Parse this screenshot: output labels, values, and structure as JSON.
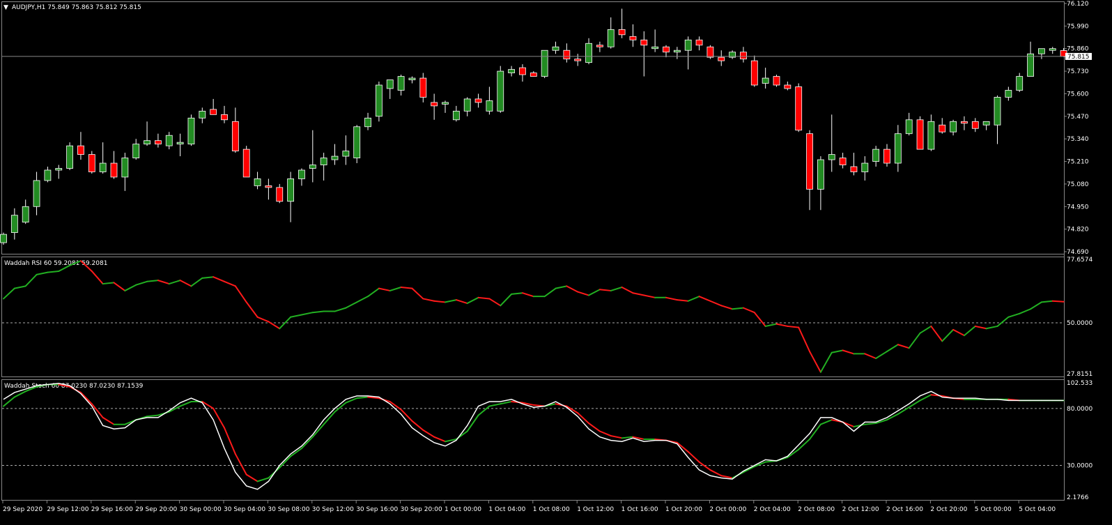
{
  "header": {
    "symbol_info": "AUDJPY,H1  75.849 75.863 75.812 75.815",
    "rsi_title": "Waddah RSI 60 59.2081 59.2081",
    "stoch_title": "Waddah Stoch 60 87.0230 87.0230 87.1539"
  },
  "price_pane": {
    "ticks": [
      "76.120",
      "75.990",
      "75.860",
      "75.730",
      "75.600",
      "75.470",
      "75.340",
      "75.210",
      "75.080",
      "74.950",
      "74.820",
      "74.690"
    ],
    "current_price_label": "75.815",
    "current_price": 75.815
  },
  "rsi_pane": {
    "ticks": [
      "77.6574",
      "50.0000",
      "27.8151"
    ],
    "level": 50
  },
  "stoch_pane": {
    "ticks": [
      "102.533",
      "80.0000",
      "30.0000",
      "2.1766"
    ],
    "levels": [
      80,
      30
    ]
  },
  "time_axis": [
    "29 Sep 2020",
    "29 Sep 12:00",
    "29 Sep 16:00",
    "29 Sep 20:00",
    "30 Sep 00:00",
    "30 Sep 04:00",
    "30 Sep 08:00",
    "30 Sep 12:00",
    "30 Sep 16:00",
    "30 Sep 20:00",
    "1 Oct 00:00",
    "1 Oct 04:00",
    "1 Oct 08:00",
    "1 Oct 12:00",
    "1 Oct 16:00",
    "1 Oct 20:00",
    "2 Oct 00:00",
    "2 Oct 04:00",
    "2 Oct 08:00",
    "2 Oct 12:00",
    "2 Oct 16:00",
    "2 Oct 20:00",
    "5 Oct 00:00",
    "5 Oct 04:00"
  ],
  "colors": {
    "bull": "#228B22",
    "bear": "#FF0000",
    "wick": "#FFFFFF",
    "background": "#000000",
    "line_green": "#22B022",
    "line_red": "#FF1A1A",
    "line_white": "#FFFFFF"
  },
  "chart_data": {
    "type": "candlestick",
    "timeframe": "H1",
    "symbol": "AUDJPY",
    "candles": [
      [
        74.742,
        74.8,
        74.73,
        74.79
      ],
      [
        74.8,
        74.94,
        74.76,
        74.9
      ],
      [
        74.86,
        74.99,
        74.85,
        74.95
      ],
      [
        74.95,
        75.15,
        74.9,
        75.1
      ],
      [
        75.1,
        75.18,
        75.09,
        75.16
      ],
      [
        75.16,
        75.19,
        75.11,
        75.17
      ],
      [
        75.17,
        75.32,
        75.16,
        75.3
      ],
      [
        75.3,
        75.38,
        75.22,
        75.25
      ],
      [
        75.25,
        75.27,
        75.14,
        75.15
      ],
      [
        75.15,
        75.32,
        75.14,
        75.2
      ],
      [
        75.2,
        75.27,
        75.11,
        75.12
      ],
      [
        75.12,
        75.26,
        75.04,
        75.23
      ],
      [
        75.23,
        75.34,
        75.22,
        75.31
      ],
      [
        75.31,
        75.44,
        75.3,
        75.33
      ],
      [
        75.33,
        75.37,
        75.29,
        75.31
      ],
      [
        75.3,
        75.38,
        75.28,
        75.36
      ],
      [
        75.31,
        75.37,
        75.24,
        75.32
      ],
      [
        75.31,
        75.48,
        75.3,
        75.46
      ],
      [
        75.46,
        75.52,
        75.43,
        75.5
      ],
      [
        75.51,
        75.57,
        75.48,
        75.48
      ],
      [
        75.48,
        75.53,
        75.43,
        75.45
      ],
      [
        75.44,
        75.52,
        75.26,
        75.27
      ],
      [
        75.28,
        75.3,
        75.12,
        75.12
      ],
      [
        75.07,
        75.15,
        75.05,
        75.11
      ],
      [
        75.07,
        75.11,
        74.99,
        75.06
      ],
      [
        75.06,
        75.08,
        74.97,
        74.98
      ],
      [
        74.98,
        75.15,
        74.86,
        75.11
      ],
      [
        75.11,
        75.17,
        75.07,
        75.16
      ],
      [
        75.17,
        75.39,
        75.09,
        75.19
      ],
      [
        75.19,
        75.26,
        75.1,
        75.23
      ],
      [
        75.22,
        75.31,
        75.19,
        75.24
      ],
      [
        75.24,
        75.36,
        75.19,
        75.27
      ],
      [
        75.23,
        75.42,
        75.2,
        75.41
      ],
      [
        75.41,
        75.49,
        75.39,
        75.46
      ],
      [
        75.47,
        75.67,
        75.44,
        75.65
      ],
      [
        75.63,
        75.67,
        75.57,
        75.68
      ],
      [
        75.62,
        75.71,
        75.59,
        75.7
      ],
      [
        75.68,
        75.7,
        75.66,
        75.69
      ],
      [
        75.69,
        75.72,
        75.55,
        75.58
      ],
      [
        75.55,
        75.6,
        75.45,
        75.53
      ],
      [
        75.54,
        75.56,
        75.49,
        75.55
      ],
      [
        75.45,
        75.53,
        75.44,
        75.5
      ],
      [
        75.5,
        75.58,
        75.47,
        75.57
      ],
      [
        75.57,
        75.6,
        75.52,
        75.55
      ],
      [
        75.5,
        75.64,
        75.48,
        75.56
      ],
      [
        75.5,
        75.76,
        75.49,
        75.73
      ],
      [
        75.72,
        75.76,
        75.7,
        75.74
      ],
      [
        75.75,
        75.77,
        75.67,
        75.71
      ],
      [
        75.72,
        75.73,
        75.7,
        75.7
      ],
      [
        75.7,
        75.85,
        75.69,
        75.85
      ],
      [
        75.85,
        75.9,
        75.83,
        75.87
      ],
      [
        75.85,
        75.89,
        75.78,
        75.8
      ],
      [
        75.8,
        75.83,
        75.76,
        75.79
      ],
      [
        75.78,
        75.92,
        75.77,
        75.89
      ],
      [
        75.88,
        75.9,
        75.84,
        75.87
      ],
      [
        75.87,
        76.04,
        75.86,
        75.97
      ],
      [
        75.97,
        76.09,
        75.92,
        75.94
      ],
      [
        75.93,
        76.0,
        75.87,
        75.91
      ],
      [
        75.91,
        75.96,
        75.7,
        75.88
      ],
      [
        75.86,
        75.97,
        75.84,
        75.87
      ],
      [
        75.87,
        75.88,
        75.81,
        75.84
      ],
      [
        75.84,
        75.87,
        75.8,
        75.85
      ],
      [
        75.85,
        75.93,
        75.74,
        75.91
      ],
      [
        75.91,
        75.93,
        75.85,
        75.88
      ],
      [
        75.87,
        75.88,
        75.8,
        75.81
      ],
      [
        75.81,
        75.85,
        75.76,
        75.79
      ],
      [
        75.81,
        75.85,
        75.8,
        75.84
      ],
      [
        75.84,
        75.87,
        75.78,
        75.8
      ],
      [
        75.79,
        75.82,
        75.64,
        75.65
      ],
      [
        75.66,
        75.75,
        75.63,
        75.69
      ],
      [
        75.7,
        75.71,
        75.64,
        75.65
      ],
      [
        75.65,
        75.67,
        75.62,
        75.63
      ],
      [
        75.64,
        75.66,
        75.38,
        75.39
      ],
      [
        75.37,
        75.39,
        74.93,
        75.05
      ],
      [
        75.05,
        75.24,
        74.93,
        75.22
      ],
      [
        75.22,
        75.48,
        75.15,
        75.25
      ],
      [
        75.23,
        75.26,
        75.17,
        75.19
      ],
      [
        75.18,
        75.26,
        75.13,
        75.15
      ],
      [
        75.15,
        75.24,
        75.1,
        75.2
      ],
      [
        75.21,
        75.3,
        75.18,
        75.28
      ],
      [
        75.28,
        75.31,
        75.18,
        75.2
      ],
      [
        75.2,
        75.42,
        75.15,
        75.37
      ],
      [
        75.37,
        75.49,
        75.36,
        75.45
      ],
      [
        75.45,
        75.47,
        75.28,
        75.28
      ],
      [
        75.28,
        75.48,
        75.27,
        75.44
      ],
      [
        75.42,
        75.46,
        75.37,
        75.38
      ],
      [
        75.38,
        75.45,
        75.36,
        75.44
      ],
      [
        75.44,
        75.47,
        75.39,
        75.43
      ],
      [
        75.44,
        75.46,
        75.38,
        75.4
      ],
      [
        75.42,
        75.44,
        75.39,
        75.44
      ],
      [
        75.42,
        75.59,
        75.31,
        75.58
      ],
      [
        75.58,
        75.64,
        75.56,
        75.62
      ],
      [
        75.62,
        75.72,
        75.61,
        75.7
      ],
      [
        75.7,
        75.9,
        75.7,
        75.83
      ],
      [
        75.83,
        75.86,
        75.8,
        75.86
      ],
      [
        75.85,
        75.87,
        75.83,
        75.86
      ],
      [
        75.849,
        75.863,
        75.812,
        75.815
      ]
    ],
    "rsi": [
      60.5,
      65.0,
      66.0,
      71.0,
      72.0,
      72.5,
      75.0,
      77.0,
      72.5,
      67.0,
      67.5,
      64.0,
      66.5,
      68.0,
      68.5,
      67.0,
      68.5,
      66.0,
      69.5,
      70.0,
      68.0,
      66.0,
      59.0,
      52.5,
      50.5,
      47.5,
      52.5,
      53.5,
      54.5,
      55.0,
      55.0,
      56.5,
      59.0,
      61.5,
      65.0,
      64.0,
      65.5,
      65.0,
      60.5,
      59.5,
      59.0,
      60.0,
      58.5,
      61.0,
      60.5,
      57.5,
      62.5,
      63.0,
      61.5,
      61.5,
      65.0,
      66.0,
      63.5,
      62.0,
      64.5,
      64.0,
      65.5,
      63.0,
      62.0,
      61.0,
      61.0,
      60.0,
      59.5,
      61.5,
      59.5,
      57.5,
      56.0,
      56.5,
      54.5,
      48.5,
      49.5,
      48.5,
      48.0,
      37.5,
      28.5,
      37.0,
      38.0,
      36.5,
      36.5,
      34.5,
      37.5,
      40.5,
      39.0,
      45.5,
      48.5,
      42.0,
      47.0,
      44.5,
      48.5,
      47.5,
      48.5,
      52.5,
      54.0,
      56.0,
      59.0,
      59.5,
      59.2
    ],
    "stoch_main": [
      88,
      94,
      97,
      100,
      101,
      102,
      100,
      93,
      82,
      65,
      62,
      63,
      70,
      72,
      72,
      78,
      85,
      89,
      85,
      70,
      45,
      24,
      12,
      9,
      16,
      30,
      40,
      47,
      57,
      70,
      80,
      88,
      91,
      91,
      90,
      84,
      75,
      63,
      56,
      50,
      47,
      52,
      65,
      82,
      86,
      86,
      88,
      84,
      81,
      82,
      86,
      81,
      73,
      62,
      55,
      52,
      51,
      54,
      51,
      52,
      52,
      49,
      37,
      26,
      21,
      19,
      18,
      25,
      30,
      35,
      34,
      38,
      48,
      58,
      72,
      72,
      68,
      60,
      68,
      68,
      72,
      78,
      84,
      91,
      95,
      90,
      89,
      89,
      89,
      88,
      88,
      87,
      87,
      87,
      87,
      87,
      87
    ],
    "stoch_signal": [
      82,
      90,
      95,
      99,
      101,
      101,
      99,
      94,
      84,
      72,
      66,
      66,
      70,
      73,
      74,
      77,
      82,
      86,
      86,
      80,
      63,
      40,
      22,
      16,
      19,
      28,
      38,
      45,
      55,
      66,
      77,
      85,
      89,
      90,
      89,
      86,
      79,
      69,
      61,
      55,
      51,
      53,
      60,
      74,
      82,
      84,
      86,
      85,
      83,
      82,
      84,
      82,
      76,
      67,
      60,
      56,
      54,
      55,
      53,
      53,
      52,
      50,
      42,
      33,
      26,
      21,
      19,
      24,
      29,
      33,
      34,
      37,
      44,
      53,
      66,
      70,
      68,
      64,
      66,
      67,
      70,
      75,
      81,
      87,
      92,
      91,
      89,
      88,
      88,
      88,
      88,
      88,
      87,
      87,
      87,
      87,
      87
    ]
  }
}
